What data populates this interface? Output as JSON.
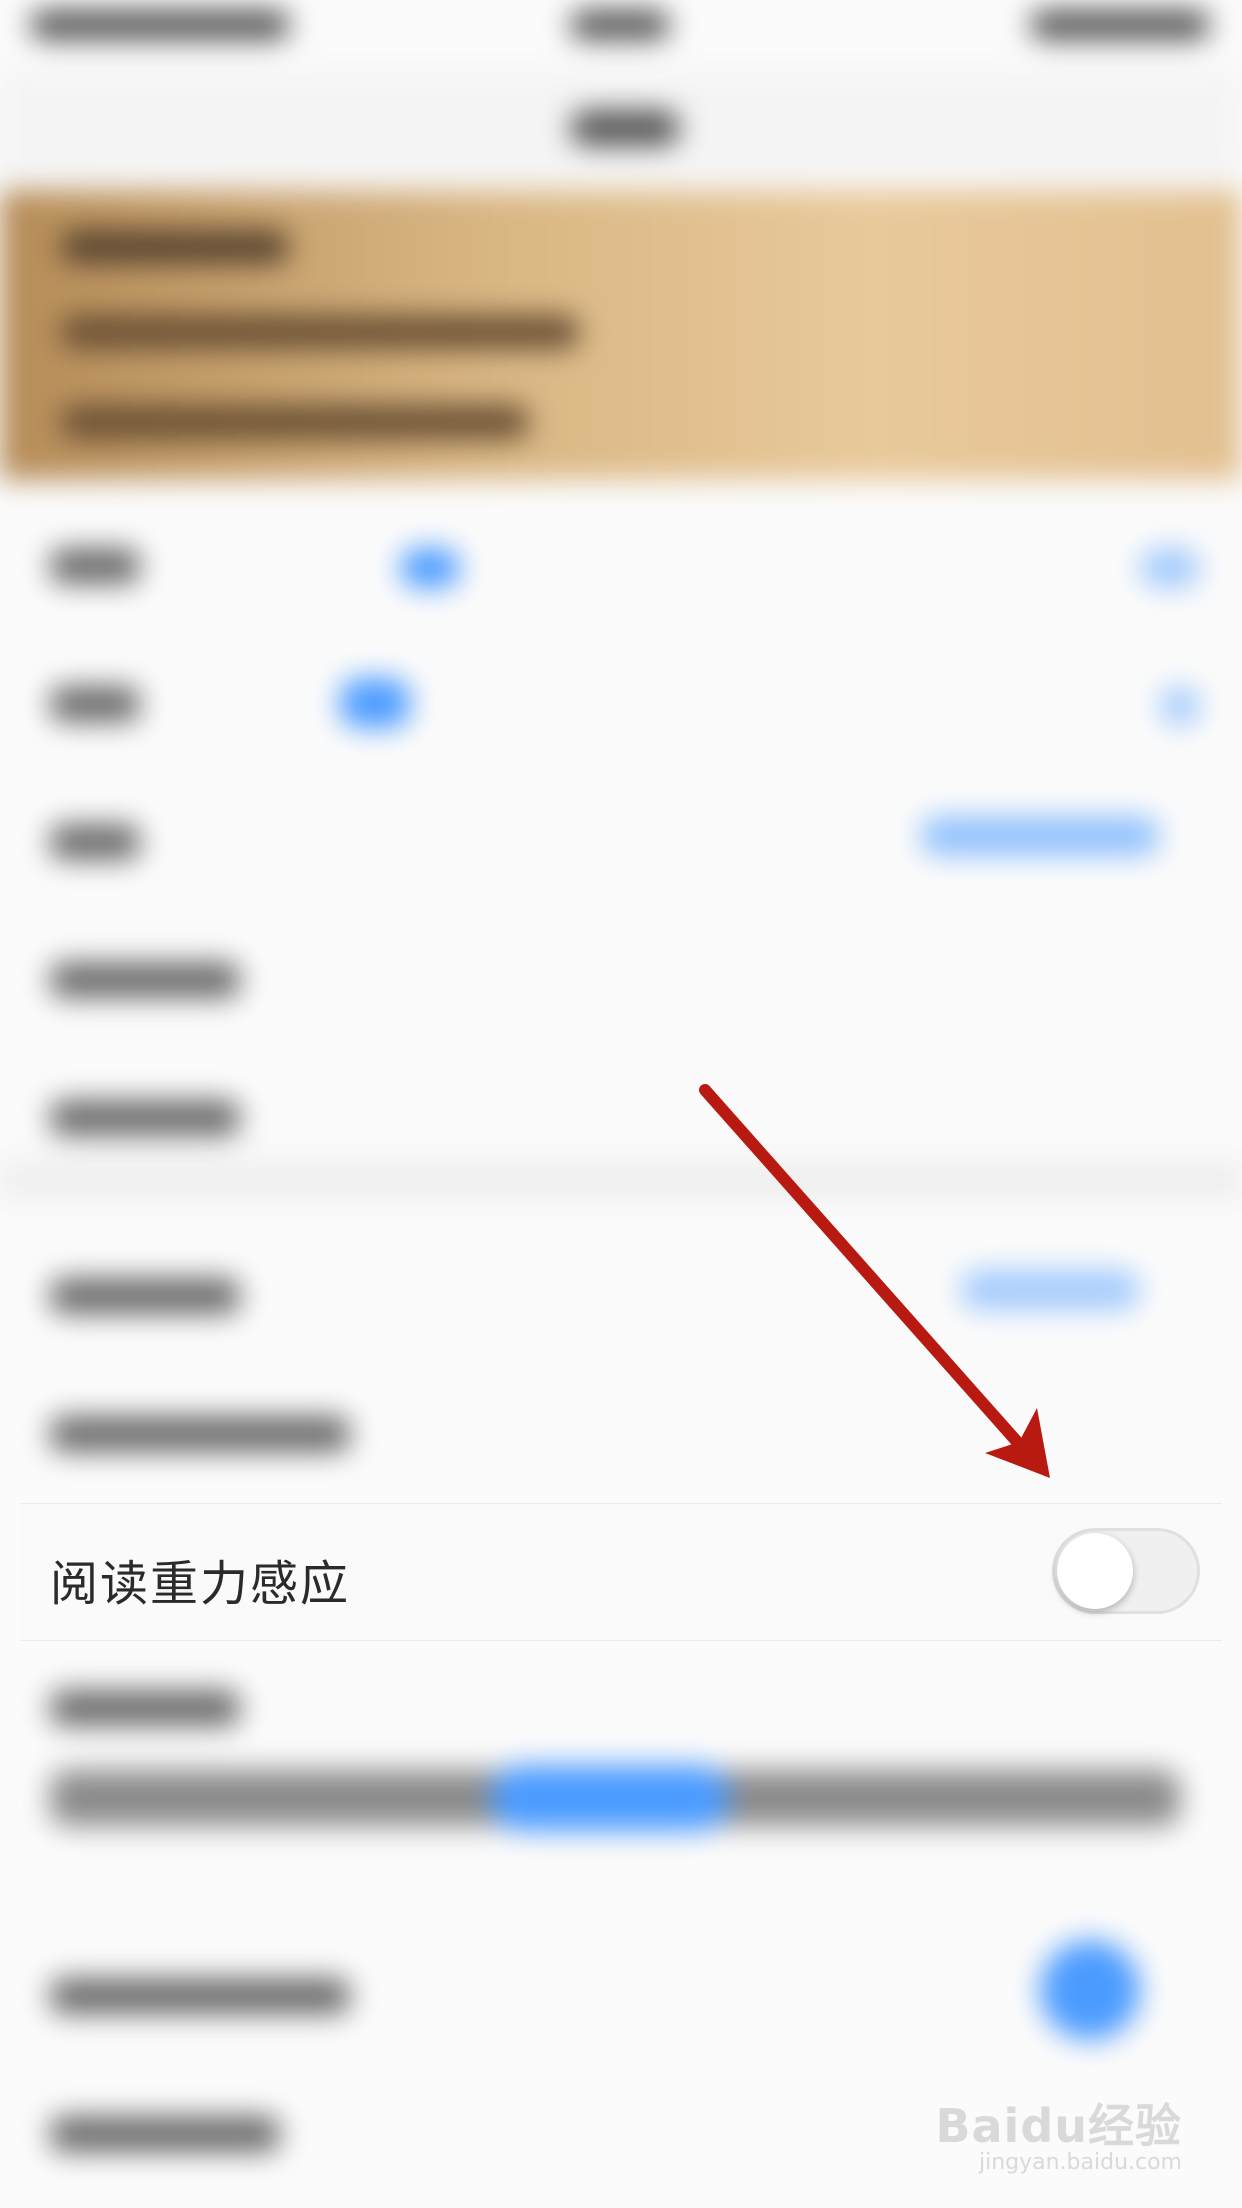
{
  "setting": {
    "label": "阅读重力感应",
    "toggle_on": false
  },
  "watermark": {
    "brand": "Baidu经验",
    "url": "jingyan.baidu.com"
  },
  "colors": {
    "arrow": "#b81a12",
    "banner": "#d9b784",
    "accent_blue": "#4b9bff"
  }
}
